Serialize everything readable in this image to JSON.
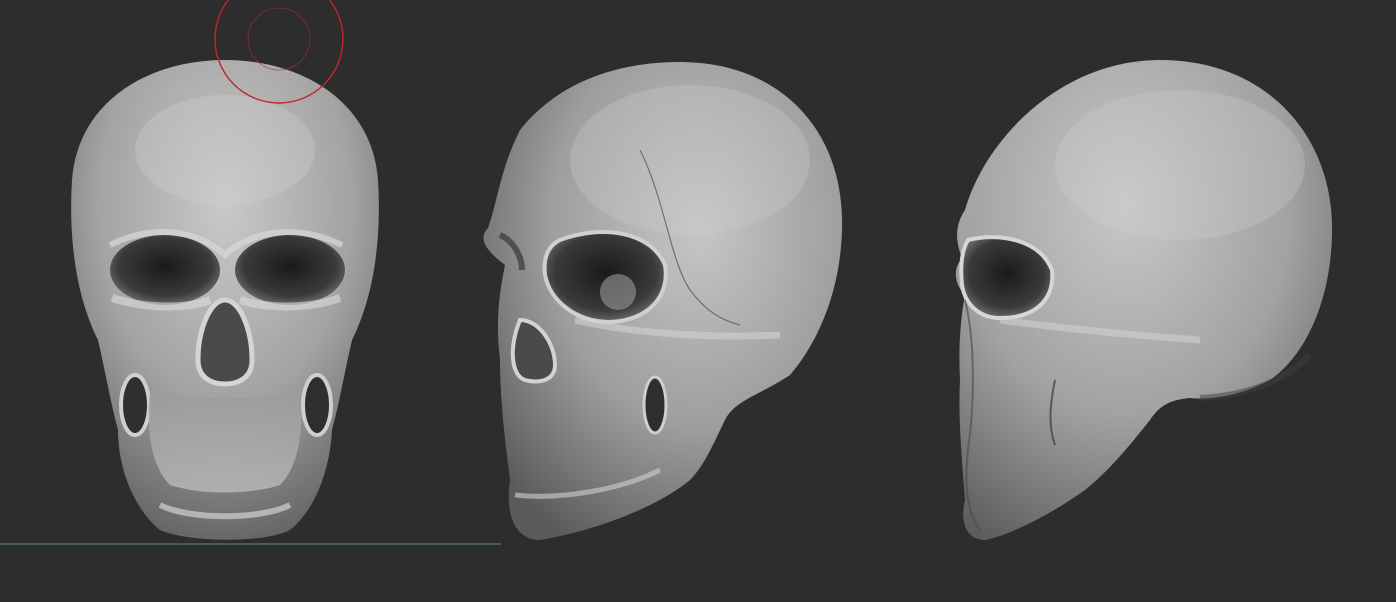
{
  "viewport": {
    "background": "#2d2d2d"
  },
  "brush_cursor": {
    "icon": "brush-cursor-icon",
    "color": "#c0262a"
  },
  "floor_grid": {
    "color": "#4e6e5c"
  },
  "models": [
    {
      "icon": "skull-front-view-icon"
    },
    {
      "icon": "skull-three-quarter-view-icon"
    },
    {
      "icon": "skull-side-view-icon"
    }
  ]
}
